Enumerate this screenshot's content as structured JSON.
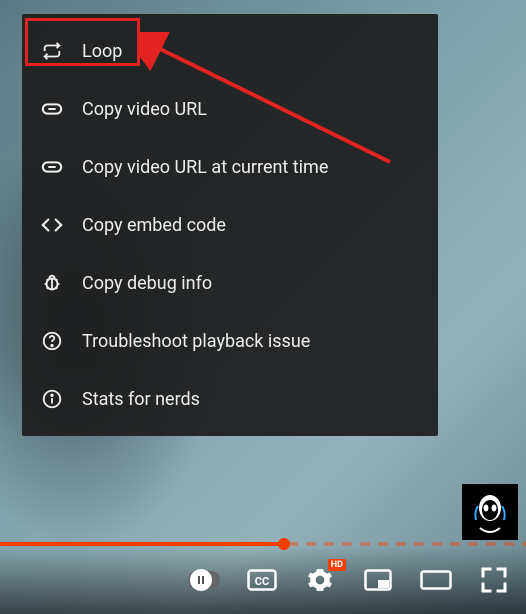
{
  "context_menu": {
    "items": [
      {
        "label": "Loop",
        "icon": "loop"
      },
      {
        "label": "Copy video URL",
        "icon": "link"
      },
      {
        "label": "Copy video URL at current time",
        "icon": "link"
      },
      {
        "label": "Copy embed code",
        "icon": "embed"
      },
      {
        "label": "Copy debug info",
        "icon": "bug"
      },
      {
        "label": "Troubleshoot playback issue",
        "icon": "help"
      },
      {
        "label": "Stats for nerds",
        "icon": "info"
      }
    ]
  },
  "annotation": {
    "highlight_target": "Loop",
    "highlight_color": "#e52222"
  },
  "player": {
    "progress_played_pct": 54,
    "hd_badge": "HD"
  }
}
